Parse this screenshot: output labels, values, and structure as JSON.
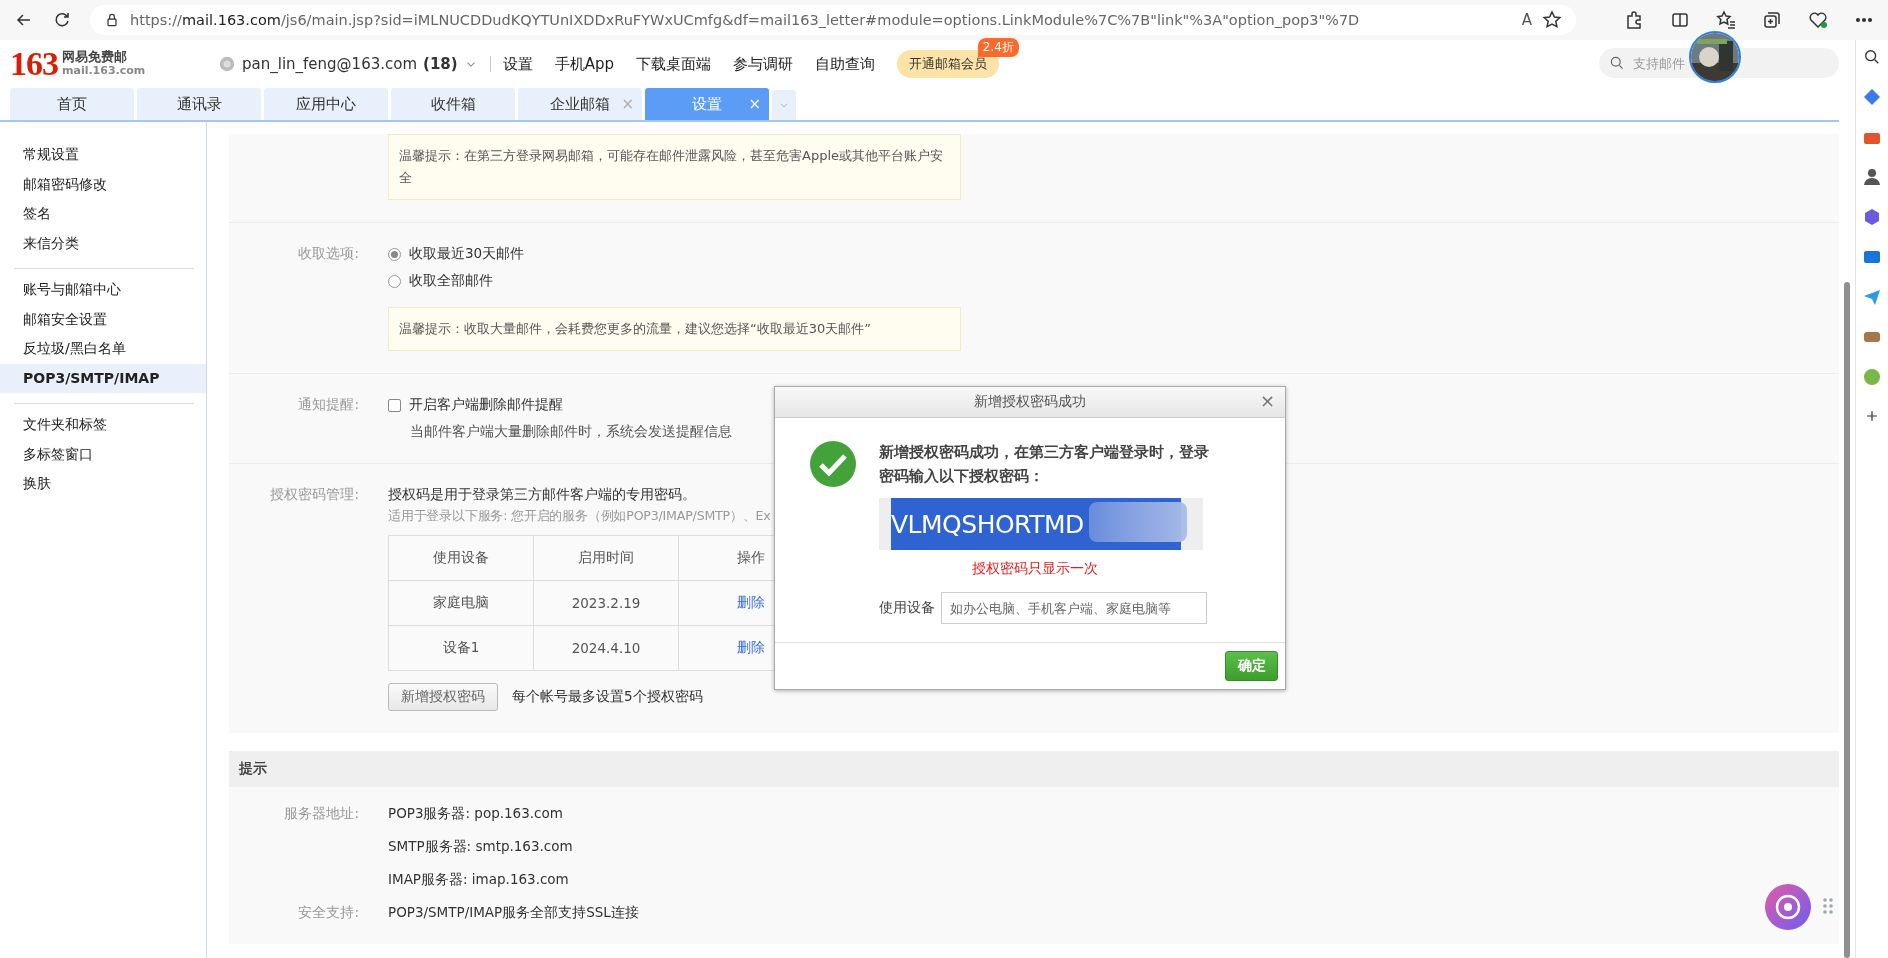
{
  "browser": {
    "url": "https://**mail.163.com**/js6/main.jsp?sid=iMLNUCDDudKQYTUnIXDDxRuFYWxUCmfg&df=mail163_letter#module=options.LinkModule%7C%7B\"link\"%3A\"option_pop3\"%7D",
    "read_aloud": "A"
  },
  "header": {
    "logo": "163",
    "logo_title": "网易免费邮",
    "logo_domain": "mail.163.com",
    "account": "pan_lin_feng@163.com",
    "unread": "(18)",
    "nav": [
      "设置",
      "手机App",
      "下载桌面端",
      "参与调研",
      "自助查询"
    ],
    "vip": {
      "label": "开通邮箱会员",
      "badge": "2.4折"
    },
    "search": {
      "placeholder": "支持邮件"
    }
  },
  "tabs": [
    {
      "label": "首页",
      "selected": false
    },
    {
      "label": "通讯录",
      "selected": false
    },
    {
      "label": "应用中心",
      "selected": false
    },
    {
      "label": "收件箱",
      "selected": false
    },
    {
      "label": "企业邮箱",
      "selected": false,
      "close": "×"
    },
    {
      "label": "设置",
      "selected": true,
      "close": "×"
    }
  ],
  "sidebar": {
    "groups": [
      [
        {
          "label": "常规设置",
          "selected": false
        },
        {
          "label": "邮箱密码修改",
          "selected": false
        },
        {
          "label": "签名",
          "selected": false
        },
        {
          "label": "来信分类",
          "selected": false
        }
      ],
      [
        {
          "label": "账号与邮箱中心",
          "selected": false
        },
        {
          "label": "邮箱安全设置",
          "selected": false
        },
        {
          "label": "反垃圾/黑白名单",
          "selected": false
        },
        {
          "label": "POP3/SMTP/IMAP",
          "selected": true
        }
      ],
      [
        {
          "label": "文件夹和标签",
          "selected": false
        },
        {
          "label": "多标签窗口",
          "selected": false
        },
        {
          "label": "换肤",
          "selected": false
        }
      ]
    ]
  },
  "settings": {
    "warning_top": "温馨提示：在第三方登录网易邮箱，可能存在邮件泄露风险，甚至危害Apple或其他平台账户安全",
    "fetch": {
      "label": "收取选项:",
      "options": [
        {
          "label": "收取最近30天邮件",
          "selected": true
        },
        {
          "label": "收取全部邮件",
          "selected": false
        }
      ],
      "warning": "温馨提示：收取大量邮件，会耗费您更多的流量，建议您选择“收取最近30天邮件”"
    },
    "notify": {
      "label": "通知提醒:",
      "option": {
        "label": "开启客户端删除邮件提醒",
        "checked": false
      },
      "hint": "当邮件客户端大量删除邮件时，系统会发送提醒信息"
    },
    "auth": {
      "label": "授权密码管理:",
      "intro": "授权码是用于登录第三方邮件客户端的专用密码。",
      "services": "适用于登录以下服务: 您开启的服务（例如POP3/IMAP/SMTP）、Ex",
      "columns": [
        "使用设备",
        "启用时间",
        "操作"
      ],
      "rows": [
        {
          "device": "家庭电脑",
          "date": "2023.2.19",
          "action": "删除"
        },
        {
          "device": "设备1",
          "date": "2024.4.10",
          "action": "删除"
        }
      ],
      "add_button": "新增授权密码",
      "limit": "每个帐号最多设置5个授权密码"
    }
  },
  "tips": {
    "title": "提示",
    "rows": [
      {
        "label": "服务器地址:",
        "value": "POP3服务器: pop.163.com"
      },
      {
        "label": "",
        "value": "SMTP服务器: smtp.163.com"
      },
      {
        "label": "",
        "value": "IMAP服务器: imap.163.com"
      },
      {
        "label": "安全支持:",
        "value": "POP3/SMTP/IMAP服务全部支持SSL连接"
      }
    ]
  },
  "dialog": {
    "title": "新增授权密码成功",
    "close": "×",
    "message": "新增授权密码成功，在第三方客户端登录时，登录密码输入以下授权密码：",
    "code": "VLMQSHORTMD",
    "note": "授权密码只显示一次",
    "device_label": "使用设备",
    "device_placeholder": "如办公电脑、手机客户端、家庭电脑等",
    "ok": "确定"
  }
}
